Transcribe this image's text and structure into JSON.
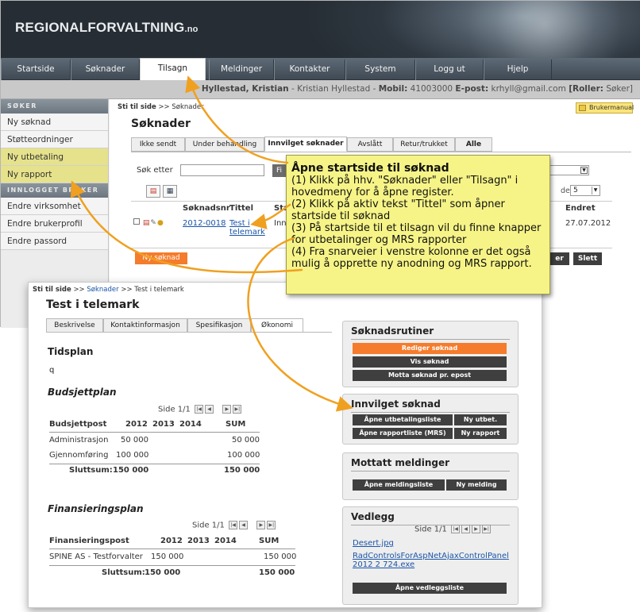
{
  "app": {
    "logo_main": "REGIONALFORVALTNING",
    "logo_suffix": ".no"
  },
  "nav": {
    "items": [
      "Startside",
      "Søknader",
      "Tilsagn",
      "Meldinger",
      "Kontakter",
      "System",
      "Logg ut",
      "Hjelp"
    ],
    "active": "Tilsagn"
  },
  "userbar": {
    "name": "Hyllestad, Kristian",
    "detail": " - Kristian Hyllestad - ",
    "mobile_label": "Mobil:",
    "mobile": " 41003000 ",
    "email_label": "E-post:",
    "email": " krhyll@gmail.com ",
    "role_label": "[Roller:",
    "role": " Søker]"
  },
  "sidebar": {
    "section1": "SØKER",
    "items1": [
      "Ny søknad",
      "Støtteordninger",
      "Ny utbetaling",
      "Ny rapport"
    ],
    "section2": "INNLOGGET BRUKER",
    "items2": [
      "Endre virksomhet",
      "Endre brukerprofil",
      "Endre passord"
    ]
  },
  "list_page": {
    "crumb_root": "Sti til side",
    "crumb_sep": ">>",
    "crumb_current": "Søknader",
    "help_button": "Brukermanual",
    "title": "Søknader",
    "tabs": [
      "Ikke sendt",
      "Under behandling",
      "Innvilget søknader",
      "Avslått",
      "Retur/trukket",
      "Alle"
    ],
    "active_tab": "Innvilget søknader",
    "search_label": "Søk etter",
    "search_value": "",
    "search_button": "Fi",
    "pagesize_label": "de",
    "pagesize": "5",
    "columns": [
      "Søknadsnr",
      "Tittel",
      "Sta",
      "Endret"
    ],
    "rows": [
      {
        "nr": "2012-0018",
        "title": "Test i telemark",
        "status": "Inn",
        "changed": "27.07.2012"
      }
    ],
    "new_button": "Ny søknad",
    "right_buttons": [
      "er",
      "Slett"
    ]
  },
  "detail_page": {
    "crumb_root": "Sti til side",
    "crumb_sep": ">>",
    "crumb_mid": "Søknader",
    "crumb_current": "Test i telemark",
    "title": "Test i telemark",
    "tabs": [
      "Beskrivelse",
      "Kontaktinformasjon",
      "Spesifikasjon",
      "Økonomi"
    ],
    "active_tab": "Økonomi",
    "schedule_title": "Tidsplan",
    "schedule_value": "q",
    "budget": {
      "title": "Budsjettplan",
      "pager": "Side 1/1",
      "columns": [
        "Budsjettpost",
        "2012",
        "2013",
        "2014",
        "SUM"
      ],
      "rows": [
        {
          "post": "Administrasjon",
          "y2012": "50 000",
          "y2013": "",
          "y2014": "",
          "sum": "50 000"
        },
        {
          "post": "Gjennomføring",
          "y2012": "100 000",
          "y2013": "",
          "y2014": "",
          "sum": "100 000"
        }
      ],
      "total_label": "Sluttsum:",
      "total_2012": "150 000",
      "total_sum": "150 000"
    },
    "financing": {
      "title": "Finansieringsplan",
      "pager": "Side 1/1",
      "columns": [
        "Finansieringspost",
        "2012",
        "2013",
        "2014",
        "SUM"
      ],
      "rows": [
        {
          "post": "SPINE AS - Testforvalter",
          "y2012": "150 000",
          "y2013": "",
          "y2014": "",
          "sum": "150 000"
        }
      ],
      "total_label": "Sluttsum:",
      "total_2012": "150 000",
      "total_sum": "150 000"
    },
    "panels": {
      "routines": {
        "title": "Søknadsrutiner",
        "buttons": [
          "Rediger søknad",
          "Vis søknad",
          "Motta søknad pr. epost"
        ]
      },
      "granted": {
        "title": "Innvilget søknad",
        "buttons": [
          "Åpne utbetalingsliste",
          "Ny utbet.",
          "Åpne rapportliste (MRS)",
          "Ny rapport"
        ]
      },
      "messages": {
        "title": "Mottatt meldinger",
        "buttons": [
          "Åpne meldingsliste",
          "Ny melding"
        ]
      },
      "attachments": {
        "title": "Vedlegg",
        "pager": "Side 1/1",
        "files": [
          "Desert.jpg",
          "RadControlsForAspNetAjaxControlPanel 2012 2 724.exe"
        ],
        "button": "Åpne vedleggsliste"
      }
    }
  },
  "callout": {
    "title": "Åpne startside til søknad",
    "lines": [
      "(1) Klikk på hhv. \"Søknader\" eller \"Tilsagn\" i",
      "hovedmeny for å åpne register.",
      "(2) Klikk på aktiv tekst \"Tittel\" som åpner",
      "startside til søknad",
      "(3) På startside til et tilsagn vil du finne knapper",
      "for utbetalinger og MRS rapporter",
      "(4) Fra snarveier i venstre kolonne er det også",
      "mulig å opprette ny anodning og MRS rapport."
    ]
  },
  "colors": {
    "accent_orange": "#f47c2c",
    "callout_yellow": "#f6f487",
    "sidebar_highlight": "#e6e28c",
    "link_blue": "#1a55a8"
  }
}
